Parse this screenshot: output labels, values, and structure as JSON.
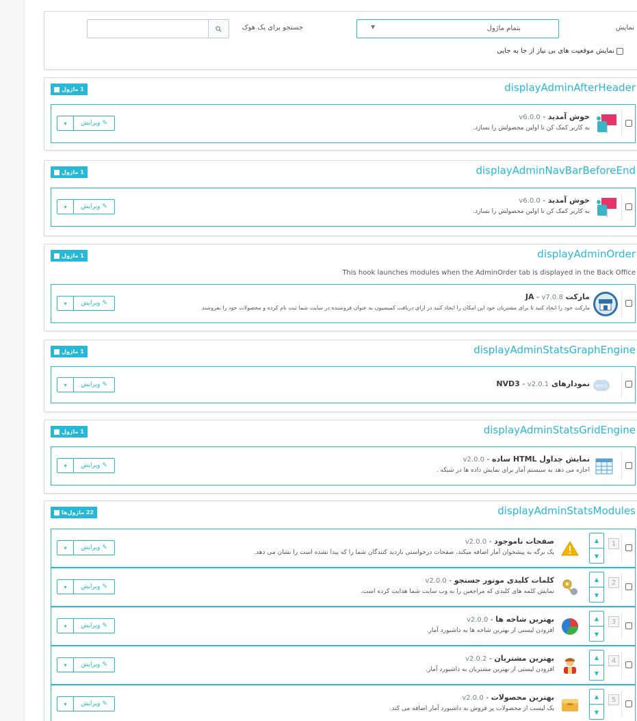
{
  "filters": {
    "display_label": "نمایش",
    "module_select_value": "بتمام ماژول",
    "search_label": "جستجو برای یک هوک",
    "search_value": "",
    "search_icon": "search-icon",
    "nonmovable_label": "نمایش موقعیت های بی نیاز از جا به جایی"
  },
  "edit_label": "ویرایش",
  "hooks": [
    {
      "title": "displayAdminAfterHeader",
      "badge": "1 ماژول",
      "description": "",
      "modules": [
        {
          "name": "خوش آمدید",
          "version": "v6.0.0",
          "desc": "به کاربر کمک کن تا اولین محصولش را بسازد.",
          "icon": "welcome-presentation-icon"
        }
      ]
    },
    {
      "title": "displayAdminNavBarBeforeEnd",
      "badge": "1 ماژول",
      "description": "",
      "modules": [
        {
          "name": "خوش آمدید",
          "version": "v6.0.0",
          "desc": "به کاربر کمک کن تا اولین محصولش را بسازد.",
          "icon": "welcome-presentation-icon"
        }
      ]
    },
    {
      "title": "displayAdminOrder",
      "badge": "1 ماژول",
      "description": "This hook launches modules when the AdminOrder tab is displayed in the Back Office",
      "modules": [
        {
          "name": "مارکت JA",
          "version": "v7.0.8",
          "desc": "مارکت خود را ایجاد کنید تا برای مشتریان خود این امکان را ایجاد کنید در ازای دریافت کمیسیون به عنوان فروشنده در سایت شما ثبت نام کرده و محصولات خود را بفروشند",
          "icon": "marketplace-store-icon"
        }
      ]
    },
    {
      "title": "displayAdminStatsGraphEngine",
      "badge": "1 ماژول",
      "description": "",
      "modules": [
        {
          "name": "نمودارهای NVD3",
          "version": "v2.0.1",
          "desc": "",
          "icon": "nvd3-logo-icon"
        }
      ]
    },
    {
      "title": "displayAdminStatsGridEngine",
      "badge": "1 ماژول",
      "description": "",
      "modules": [
        {
          "name": "نمایش جداول HTML ساده",
          "version": "v2.0.0",
          "desc": "اجازه می دهد به سیستم آمار برای نمایش داده ها در شبکه .",
          "icon": "grid-table-icon"
        }
      ]
    },
    {
      "title": "displayAdminStatsModules",
      "badge": "22 ماژول‌ها",
      "description": "",
      "modules": [
        {
          "pos": "1",
          "name": "صفحات ناموجود",
          "version": "v2.0.0",
          "desc": "یک برگه به پیشخوان آمار اضافه میکند، صفحات درخواستی بازدید کنندگان شما را که پیدا نشده است را نشان می دهد.",
          "icon": "warning-triangle-icon"
        },
        {
          "pos": "2",
          "name": "کلمات کلیدی موتور جستجو",
          "version": "v2.0.0",
          "desc": "نمایش کلمه های کلیدی که مراجعین را به وب سایت شما هدایت کرده است.",
          "icon": "keys-icon"
        },
        {
          "pos": "3",
          "name": "بهترین شاخه ها",
          "version": "v2.0.0",
          "desc": "افزودن لیستی از بهترین شاخه ها به داشبورد آمار.",
          "icon": "pie-chart-icon"
        },
        {
          "pos": "4",
          "name": "بهترین مشتریان",
          "version": "v2.0.2",
          "desc": "افزودن لیستی از بهترین مشتریان به داشبورد آمار.",
          "icon": "customer-avatar-icon"
        },
        {
          "pos": "5",
          "name": "بهترین محصولات",
          "version": "v2.0.0",
          "desc": "یک لیست از محصولات پر فروش به داشبورد آمار اضافه می کند.",
          "icon": "product-box-icon"
        }
      ]
    }
  ]
}
